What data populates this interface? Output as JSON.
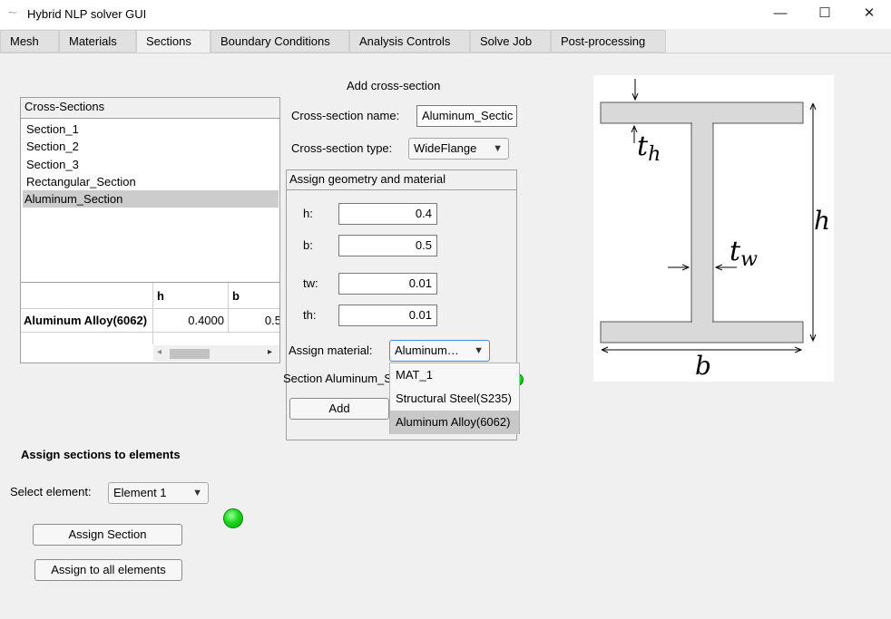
{
  "window": {
    "title": "Hybrid NLP solver GUI",
    "minimize": "—",
    "maximize": "☐",
    "close": "✕"
  },
  "tabs": [
    {
      "label": "Mesh"
    },
    {
      "label": "Materials"
    },
    {
      "label": "Sections"
    },
    {
      "label": "Boundary Conditions"
    },
    {
      "label": "Analysis Controls"
    },
    {
      "label": "Solve Job"
    },
    {
      "label": "Post-processing"
    }
  ],
  "cross_sections": {
    "title": "Cross-Sections",
    "items": [
      "Section_1",
      "Section_2",
      "Section_3",
      "Rectangular_Section",
      "Aluminum_Section"
    ],
    "selected": "Aluminum_Section"
  },
  "table": {
    "headers": [
      "h",
      "b"
    ],
    "row_label": "Aluminum Alloy(6062)",
    "values": [
      "0.4000",
      "0.5"
    ],
    "scroll_left": "◂",
    "scroll_right": "▸"
  },
  "add_section": {
    "heading": "Add cross-section",
    "name_label": "Cross-section name:",
    "name_value": "Aluminum_Sectic",
    "type_label": "Cross-section type:",
    "type_value": "WideFlange",
    "geometry_title": "Assign geometry and material",
    "fields": [
      {
        "label": "h:",
        "value": "0.4"
      },
      {
        "label": "b:",
        "value": "0.5"
      },
      {
        "label": "tw:",
        "value": "0.01"
      },
      {
        "label": "th:",
        "value": "0.01"
      }
    ],
    "material_label": "Assign material:",
    "material_value": "Aluminum…",
    "material_options": [
      "MAT_1",
      "Structural Steel(S235)",
      "Aluminum Alloy(6062)"
    ],
    "material_selected": "Aluminum Alloy(6062)",
    "status_text": "Section Aluminum_S",
    "add_label": "Add"
  },
  "assign": {
    "heading": "Assign sections to elements",
    "element_label": "Select element:",
    "element_value": "Element 1",
    "assign_label": "Assign Section",
    "assign_all_label": "Assign to all elements"
  },
  "diagram": {
    "label_h": "h",
    "label_b": "b",
    "label_th_main": "t",
    "label_th_sub": "h",
    "label_tw_main": "t",
    "label_tw_sub": "w"
  },
  "icons": {
    "dropdown_arrow": "▼"
  },
  "colors": {
    "led": "#1ed81e",
    "selection": "#cccccc",
    "flange_fill": "#d9d9d9"
  }
}
